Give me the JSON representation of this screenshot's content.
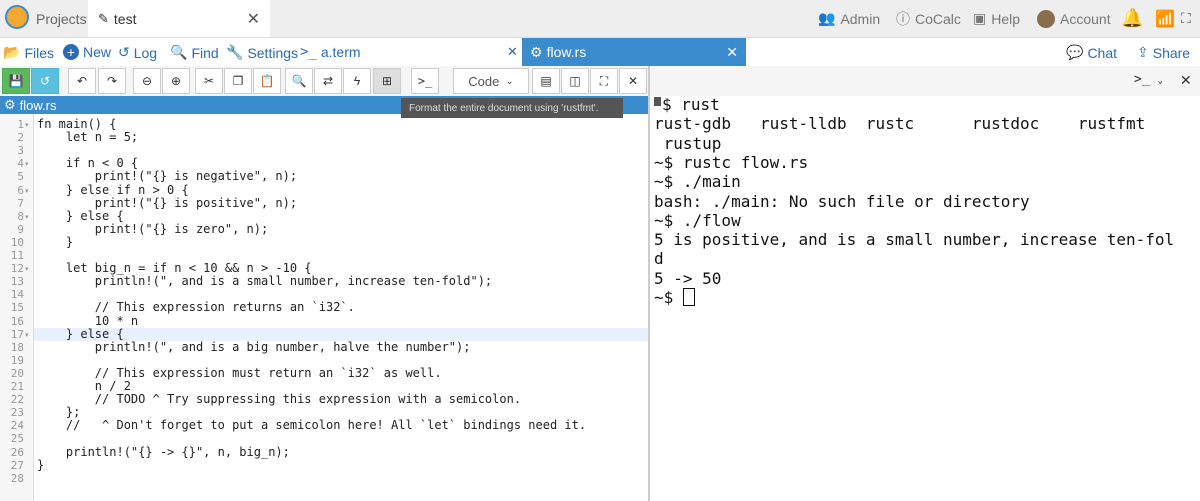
{
  "topbar": {
    "projects": "Projects",
    "tab_title": "test",
    "admin": "Admin",
    "cocalc": "CoCalc",
    "help": "Help",
    "account": "Account"
  },
  "filebar": {
    "files": "Files",
    "new": "New",
    "log": "Log",
    "find": "Find",
    "settings": "Settings",
    "term": "a.term",
    "file_tab": "flow.rs",
    "chat": "Chat",
    "share": "Share"
  },
  "toolbar": {
    "mode": "Code",
    "tooltip": "Format the entire document using 'rustfmt'."
  },
  "editor": {
    "title": "flow.rs",
    "line_numbers": [
      "1",
      "2",
      "3",
      "4",
      "5",
      "6",
      "7",
      "8",
      "9",
      "10",
      "11",
      "12",
      "13",
      "14",
      "15",
      "16",
      "17",
      "18",
      "19",
      "20",
      "21",
      "22",
      "23",
      "24",
      "25",
      "26",
      "27",
      "28"
    ],
    "lines": [
      "fn main() {",
      "    let n = 5;",
      "",
      "    if n < 0 {",
      "        print!(\"{} is negative\", n);",
      "    } else if n > 0 {",
      "        print!(\"{} is positive\", n);",
      "    } else {",
      "        print!(\"{} is zero\", n);",
      "    }",
      "",
      "    let big_n = if n < 10 && n > -10 {",
      "        println!(\", and is a small number, increase ten-fold\");",
      "",
      "        // This expression returns an `i32`.",
      "        10 * n",
      "    } else {",
      "        println!(\", and is a big number, halve the number\");",
      "",
      "        // This expression must return an `i32` as well.",
      "        n / 2",
      "        // TODO ^ Try suppressing this expression with a semicolon.",
      "    };",
      "    //   ^ Don't forget to put a semicolon here! All `let` bindings need it.",
      "",
      "    println!(\"{} -> {}\", n, big_n);",
      "}",
      ""
    ]
  },
  "terminal": {
    "lines": [
      "$ rust",
      "rust-gdb   rust-lldb  rustc      rustdoc    rustfmt",
      " rustup",
      "~$ rustc flow.rs",
      "~$ ./main",
      "bash: ./main: No such file or directory",
      "~$ ./flow",
      "5 is positive, and is a small number, increase ten-fol",
      "d",
      "5 -> 50",
      "~$ "
    ]
  },
  "colors": {
    "accent": "#3b8bcf",
    "save": "#5cb85c",
    "timetravel": "#5bc0de"
  }
}
